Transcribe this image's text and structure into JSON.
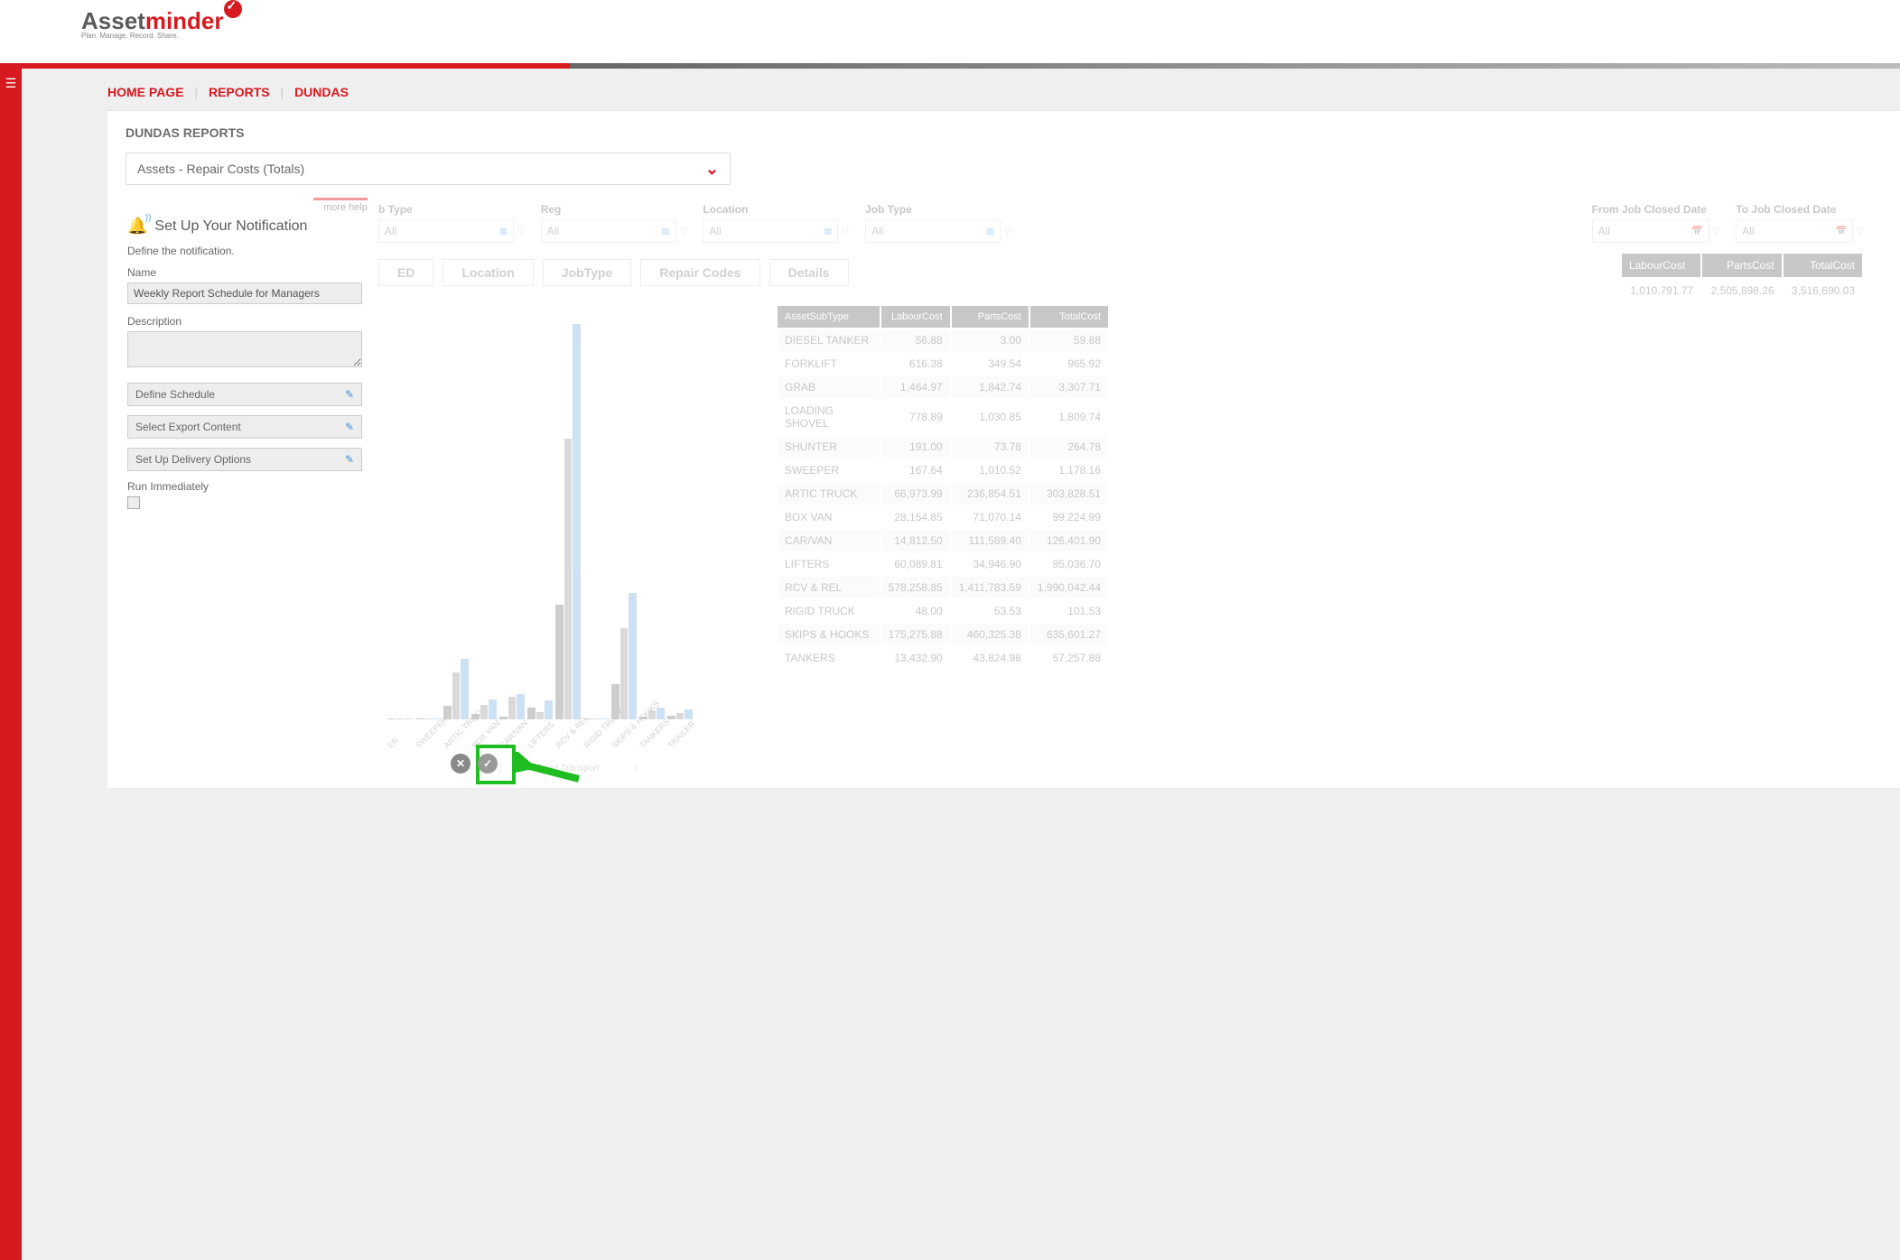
{
  "logo": {
    "part1": "Asset",
    "part2": "minder",
    "tagline": "Plan. Manage. Record. Share."
  },
  "breadcrumb": {
    "home": "HOME PAGE",
    "mid": "REPORTS",
    "current": "DUNDAS"
  },
  "panel_title": "DUNDAS REPORTS",
  "report_dropdown": "Assets - Repair Costs (Totals)",
  "more_help": "more help",
  "notification": {
    "title": "Set Up Your Notification",
    "subtitle": "Define the notification.",
    "name_label": "Name",
    "name_value": "Weekly Report Schedule for Managers",
    "desc_label": "Description",
    "step1": "Define Schedule",
    "step2": "Select Export Content",
    "step3": "Set Up Delivery Options",
    "run_label": "Run Immediately"
  },
  "filters": {
    "from_date": {
      "label": "From Job Closed Date",
      "value": "All"
    },
    "to_date": {
      "label": "To Job Closed Date",
      "value": "All"
    },
    "subtype": {
      "label": "b Type",
      "value": "All"
    },
    "reg": {
      "label": "Reg",
      "value": "All"
    },
    "location": {
      "label": "Location",
      "value": "All"
    },
    "jobtype": {
      "label": "Job Type",
      "value": "All"
    }
  },
  "pills": {
    "p1": "ED",
    "p2": "Location",
    "p3": "JobType",
    "p4": "Repair Codes",
    "p5": "Details"
  },
  "summary": {
    "h1": "LabourCost",
    "h2": "PartsCost",
    "h3": "TotalCost",
    "v1": "1,010,791.77",
    "v2": "2,505,898.26",
    "v3": "3,516,690.03"
  },
  "table": {
    "h0": "AssetSubType",
    "h1": "LabourCost",
    "h2": "PartsCost",
    "h3": "TotalCost",
    "rows": [
      {
        "n": "DIESEL TANKER",
        "l": "56.88",
        "p": "3.00",
        "t": "59.88"
      },
      {
        "n": "FORKLIFT",
        "l": "616.38",
        "p": "349.54",
        "t": "965.92"
      },
      {
        "n": "GRAB",
        "l": "1,464.97",
        "p": "1,842.74",
        "t": "3,307.71"
      },
      {
        "n": "LOADING SHOVEL",
        "l": "778.89",
        "p": "1,030.85",
        "t": "1,809.74"
      },
      {
        "n": "SHUNTER",
        "l": "191.00",
        "p": "73.78",
        "t": "264.78"
      },
      {
        "n": "SWEEPER",
        "l": "167.64",
        "p": "1,010.52",
        "t": "1,178.16"
      },
      {
        "n": "ARTIC TRUCK",
        "l": "66,973.99",
        "p": "236,854.51",
        "t": "303,828.51"
      },
      {
        "n": "BOX VAN",
        "l": "28,154.85",
        "p": "71,070.14",
        "t": "99,224.99"
      },
      {
        "n": "CAR/VAN",
        "l": "14,812.50",
        "p": "111,589.40",
        "t": "126,401.90"
      },
      {
        "n": "LIFTERS",
        "l": "60,089.81",
        "p": "34,946.90",
        "t": "95,036.70"
      },
      {
        "n": "RCV & REL",
        "l": "578,258.85",
        "p": "1,411,783.59",
        "t": "1,990,042.44"
      },
      {
        "n": "RIGID TRUCK",
        "l": "48.00",
        "p": "53.53",
        "t": "101.53"
      },
      {
        "n": "SKIPS & HOOKS",
        "l": "175,275.88",
        "p": "460,325.38",
        "t": "635,601.27"
      },
      {
        "n": "TANKERS",
        "l": "13,432.90",
        "p": "43,824.98",
        "t": "57,257.88"
      }
    ]
  },
  "chart_data": {
    "type": "bar",
    "title": "",
    "xlabel": "Road Transport",
    "ylabel": "",
    "ylim": [
      0,
      2000000
    ],
    "categories": [
      "ER",
      "SWEEPER",
      "ARTIC TRUCK",
      "BOX VAN",
      "CAR/VAN",
      "LIFTERS",
      "RCV & REL",
      "RIGID TRUCK",
      "SKIPS & HOOKS",
      "TANKERS",
      "TRAILER"
    ],
    "series": [
      {
        "name": "LabourCost",
        "values": [
          1000,
          167,
          66973,
          28154,
          14812,
          60089,
          578258,
          48,
          175275,
          13432,
          20000
        ]
      },
      {
        "name": "PartsCost",
        "values": [
          1500,
          1010,
          236854,
          71070,
          111589,
          34946,
          1411783,
          53,
          460325,
          43824,
          30000
        ]
      },
      {
        "name": "TotalCost",
        "values": [
          2500,
          1178,
          303828,
          99224,
          126401,
          95036,
          1990042,
          101,
          635601,
          57257,
          50000
        ]
      }
    ]
  },
  "chart_xlabel": "Road Transport"
}
